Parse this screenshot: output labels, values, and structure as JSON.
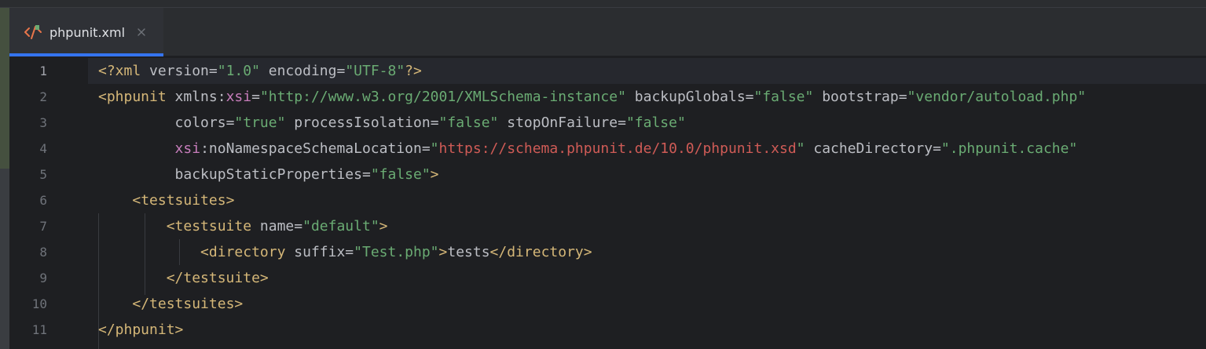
{
  "tab": {
    "label": "phpunit.xml",
    "icon": "xml-file-icon",
    "close_icon": "close-icon",
    "active_color": "#3574f0"
  },
  "editor": {
    "line_numbers": [
      "1",
      "2",
      "3",
      "4",
      "5",
      "6",
      "7",
      "8",
      "9",
      "10",
      "11"
    ],
    "current_line": 1,
    "lines": [
      [
        {
          "t": "tag",
          "v": "<?xml "
        },
        {
          "t": "attr",
          "v": "version"
        },
        {
          "t": "eq",
          "v": "="
        },
        {
          "t": "str",
          "v": "\"1.0\""
        },
        {
          "t": "attr",
          "v": " encoding"
        },
        {
          "t": "eq",
          "v": "="
        },
        {
          "t": "str",
          "v": "\"UTF-8\""
        },
        {
          "t": "tag",
          "v": "?>"
        }
      ],
      [
        {
          "t": "tag",
          "v": "<phpunit "
        },
        {
          "t": "attr",
          "v": "xmlns:"
        },
        {
          "t": "ns",
          "v": "xsi"
        },
        {
          "t": "eq",
          "v": "="
        },
        {
          "t": "str",
          "v": "\"http://www.w3.org/2001/XMLSchema-instance\""
        },
        {
          "t": "attr",
          "v": " backupGlobals"
        },
        {
          "t": "eq",
          "v": "="
        },
        {
          "t": "str",
          "v": "\"false\""
        },
        {
          "t": "attr",
          "v": " bootstrap"
        },
        {
          "t": "eq",
          "v": "="
        },
        {
          "t": "str",
          "v": "\"vendor/autoload.php\""
        }
      ],
      [
        {
          "t": "text",
          "v": "         "
        },
        {
          "t": "attr",
          "v": "colors"
        },
        {
          "t": "eq",
          "v": "="
        },
        {
          "t": "str",
          "v": "\"true\""
        },
        {
          "t": "attr",
          "v": " processIsolation"
        },
        {
          "t": "eq",
          "v": "="
        },
        {
          "t": "str",
          "v": "\"false\""
        },
        {
          "t": "attr",
          "v": " stopOnFailure"
        },
        {
          "t": "eq",
          "v": "="
        },
        {
          "t": "str",
          "v": "\"false\""
        }
      ],
      [
        {
          "t": "text",
          "v": "         "
        },
        {
          "t": "ns",
          "v": "xsi"
        },
        {
          "t": "attr",
          "v": ":noNamespaceSchemaLocation"
        },
        {
          "t": "eq",
          "v": "="
        },
        {
          "t": "str",
          "v": "\""
        },
        {
          "t": "url",
          "v": "https://schema.phpunit.de/10.0/phpunit.xsd"
        },
        {
          "t": "str",
          "v": "\""
        },
        {
          "t": "attr",
          "v": " cacheDirectory"
        },
        {
          "t": "eq",
          "v": "="
        },
        {
          "t": "str",
          "v": "\".phpunit.cache\""
        }
      ],
      [
        {
          "t": "text",
          "v": "         "
        },
        {
          "t": "attr",
          "v": "backupStaticProperties"
        },
        {
          "t": "eq",
          "v": "="
        },
        {
          "t": "str",
          "v": "\"false\""
        },
        {
          "t": "tag",
          "v": ">"
        }
      ],
      [
        {
          "t": "text",
          "v": "    "
        },
        {
          "t": "tag",
          "v": "<testsuites>"
        }
      ],
      [
        {
          "t": "text",
          "v": "        "
        },
        {
          "t": "tag",
          "v": "<testsuite "
        },
        {
          "t": "attr",
          "v": "name"
        },
        {
          "t": "eq",
          "v": "="
        },
        {
          "t": "str",
          "v": "\"default\""
        },
        {
          "t": "tag",
          "v": ">"
        }
      ],
      [
        {
          "t": "text",
          "v": "            "
        },
        {
          "t": "tag",
          "v": "<directory "
        },
        {
          "t": "attr",
          "v": "suffix"
        },
        {
          "t": "eq",
          "v": "="
        },
        {
          "t": "str",
          "v": "\"Test.php\""
        },
        {
          "t": "tag",
          "v": ">"
        },
        {
          "t": "text",
          "v": "tests"
        },
        {
          "t": "tag",
          "v": "</directory>"
        }
      ],
      [
        {
          "t": "text",
          "v": "        "
        },
        {
          "t": "tag",
          "v": "</testsuite>"
        }
      ],
      [
        {
          "t": "text",
          "v": "    "
        },
        {
          "t": "tag",
          "v": "</testsuites>"
        }
      ],
      [
        {
          "t": "tag",
          "v": "</phpunit>"
        }
      ]
    ]
  }
}
